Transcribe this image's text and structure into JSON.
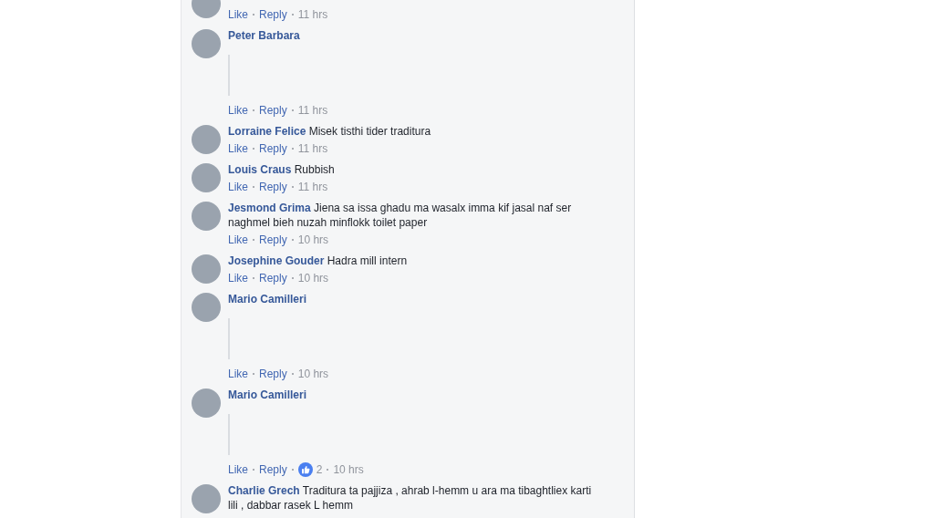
{
  "comments": [
    {
      "kind": "cut",
      "like": "Like",
      "reply": "Reply",
      "time": "11 hrs"
    },
    {
      "kind": "sticker",
      "name": "Peter Barbara",
      "like": "Like",
      "reply": "Reply",
      "time": "11 hrs"
    },
    {
      "kind": "text",
      "name": "Lorraine Felice",
      "text": "Misek tisthi tider traditura",
      "like": "Like",
      "reply": "Reply",
      "time": "11 hrs"
    },
    {
      "kind": "text",
      "name": "Louis Craus",
      "text": "Rubbish",
      "like": "Like",
      "reply": "Reply",
      "time": "11 hrs"
    },
    {
      "kind": "text",
      "name": "Jesmond Grima",
      "text": "Jiena sa issa ghadu ma wasalx imma kif jasal naf ser naghmel bieh nuzah minflokk toilet paper",
      "like": "Like",
      "reply": "Reply",
      "time": "10 hrs"
    },
    {
      "kind": "text",
      "name": "Josephine Gouder",
      "text": "Hadra mill intern",
      "like": "Like",
      "reply": "Reply",
      "time": "10 hrs"
    },
    {
      "kind": "sticker",
      "name": "Mario Camilleri",
      "like": "Like",
      "reply": "Reply",
      "time": "10 hrs"
    },
    {
      "kind": "sticker",
      "name": "Mario Camilleri",
      "like": "Like",
      "reply": "Reply",
      "reactions": "2",
      "time": "10 hrs"
    },
    {
      "kind": "text",
      "name": "Charlie Grech",
      "text": "Traditura ta pajjiza , ahrab l-hemm u ara ma tibaghtliex karti lili , dabbar rasek L hemm"
    }
  ]
}
